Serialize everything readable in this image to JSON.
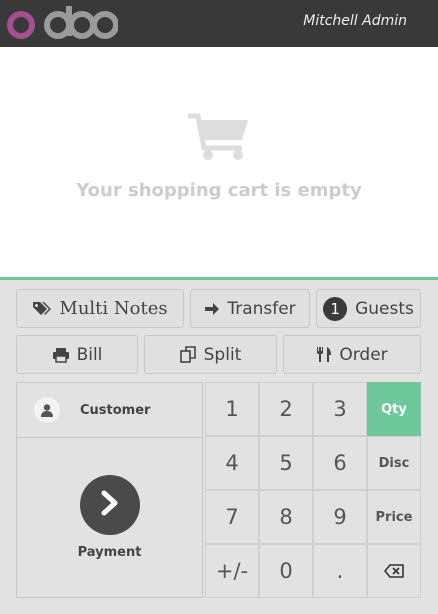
{
  "header": {
    "logo_text": "odoo",
    "user_name": "Mitchell Admin"
  },
  "cart": {
    "empty_message": "Your shopping cart is empty",
    "icon": "shopping-cart-icon"
  },
  "control_buttons": {
    "multi_notes": "Multi Notes",
    "transfer": "Transfer",
    "guests_count": "1",
    "guests": "Guests",
    "bill": "Bill",
    "split": "Split",
    "order": "Order"
  },
  "actionpad": {
    "customer": "Customer",
    "payment": "Payment"
  },
  "numpad": {
    "keys": [
      "1",
      "2",
      "3",
      "4",
      "5",
      "6",
      "7",
      "8",
      "9",
      "+/-",
      "0",
      "."
    ],
    "modes": [
      "Qty",
      "Disc",
      "Price"
    ],
    "active_mode": "Qty",
    "backspace_icon": "backspace-icon"
  },
  "colors": {
    "topbar": "#393939",
    "accent_green": "#6ec89b",
    "logo_purple": "#a34f92",
    "logo_grey": "#9a9a9a"
  }
}
